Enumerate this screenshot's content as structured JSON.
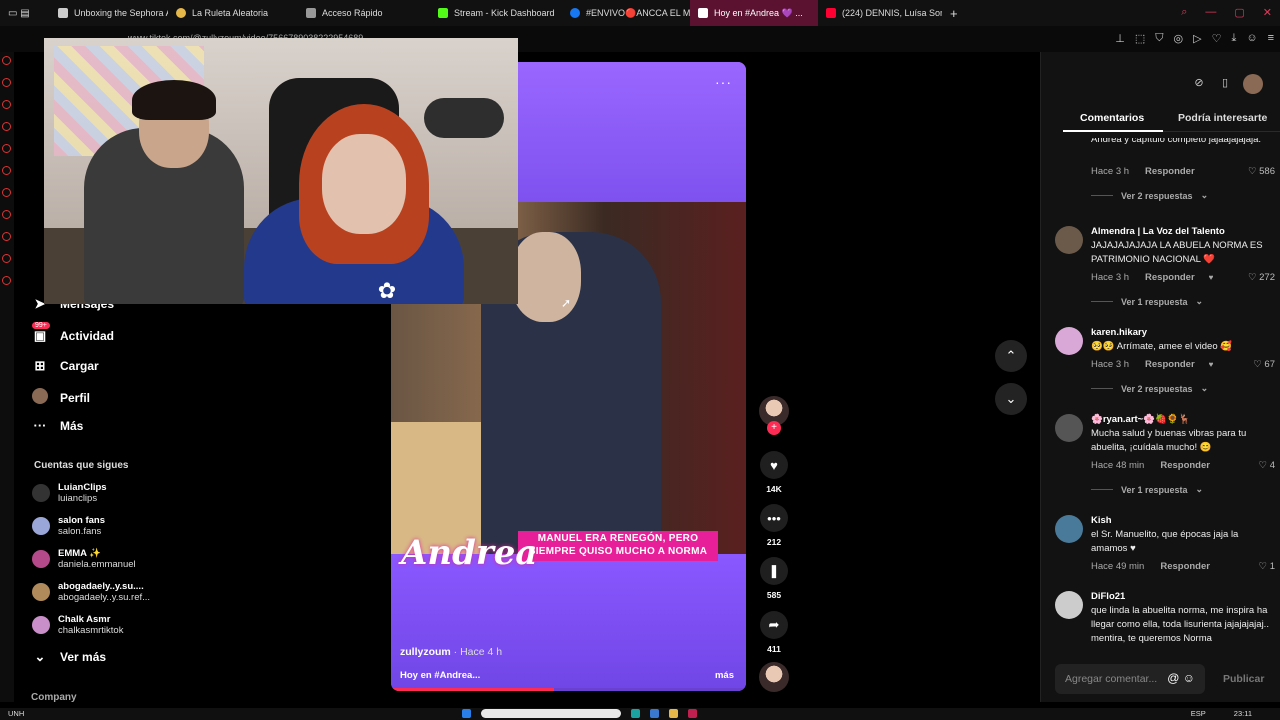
{
  "browser": {
    "tabs": [
      {
        "label": "Unboxing the Sephora Ad",
        "color": "#cccccc"
      },
      {
        "label": "La Ruleta Aleatoria",
        "color": "#e6b84a"
      },
      {
        "label": "Acceso Rápido",
        "color": "#999999"
      },
      {
        "label": "Stream - Kick Dashboard",
        "color": "#53fc18"
      },
      {
        "label": "#ENVIVO🔴ANCCA EL M",
        "color": "#1877f2"
      },
      {
        "label": "Hoy en #Andrea 💜 ...",
        "color": "#ffffff"
      },
      {
        "label": "(224) DENNIS, Luísa Sonz",
        "color": "#ff0033"
      }
    ],
    "new_tab_icon": "plus-icon",
    "url": "www.tiktok.com/@zullyzoum/video/7566789038222954689"
  },
  "nav": {
    "items": [
      {
        "label": "Mensajes",
        "icon": "paper-plane-icon"
      },
      {
        "label": "Actividad",
        "icon": "inbox-icon"
      },
      {
        "label": "Cargar",
        "icon": "upload-plus-icon"
      },
      {
        "label": "Perfil",
        "icon": "profile-avatar-icon"
      },
      {
        "label": "Más",
        "icon": "more-dots-icon"
      }
    ],
    "activity_badge": "99+",
    "following_title": "Cuentas que sigues",
    "following": [
      {
        "name": "LuianClips",
        "handle": "luianclips",
        "color": "#333333"
      },
      {
        "name": "salon fans",
        "handle": "salon.fans",
        "color": "#9aa6d8"
      },
      {
        "name": "EMMA ✨",
        "handle": "daniela.emmanuel",
        "color": "#b54a8a"
      },
      {
        "name": "abogadaely..y.su....",
        "handle": "abogadaely..y.su.ref...",
        "color": "#b08a5a"
      },
      {
        "name": "Chalk Asmr",
        "handle": "chalkasmrtiktok",
        "color": "#c98fc9"
      }
    ],
    "see_more": "Ver más",
    "company": "Company"
  },
  "video": {
    "overlay_title": "Andrea",
    "caption": "MANUEL ERA RENEGÓN, PERO SIEMPRE QUISO MUCHO A NORMA",
    "author": "zullyzoum",
    "time": " · Hace 4 h",
    "description": "Hoy en #Andrea...",
    "more": "más",
    "menu_icon": "more-horizontal-icon",
    "progress_fraction": 0.46
  },
  "actions": {
    "likes": "14K",
    "comments": "212",
    "saves": "585",
    "shares": "411"
  },
  "comments_panel": {
    "tab_comments": "Comentarios",
    "tab_interesting": "Podría interesarte",
    "items": [
      {
        "user": "",
        "text": "Andrea y capítulo completo jajaajajajaja.",
        "time": "Hace 3 h",
        "reply": "Responder",
        "likes": "586",
        "replies": "Ver 2 respuestas",
        "avatar": "#2a2a2a"
      },
      {
        "user": "Almendra | La Voz del Talento",
        "text": "JAJAJAJAJAJA LA ABUELA NORMA ES PATRIMONIO NACIONAL ❤️",
        "time": "Hace 3 h",
        "reply": "Responder",
        "likes": "272",
        "replies": "Ver 1 respuesta",
        "avatar": "#6b5a4a"
      },
      {
        "user": "karen.hikary",
        "text": "🥺🥺 Arrímate, amee el video 🥰",
        "time": "Hace 3 h",
        "reply": "Responder",
        "likes": "67",
        "replies": "Ver 2 respuestas",
        "avatar": "#d9a8d6"
      },
      {
        "user": "🌸ryan.art~🌸🍓🌻🦌",
        "text": "Mucha salud y buenas vibras para tu abuelita, ¡cuídala mucho! 😊",
        "time": "Hace 48 min",
        "reply": "Responder",
        "likes": "4",
        "replies": "Ver 1 respuesta",
        "avatar": "#555555"
      },
      {
        "user": "Kish",
        "text": "el Sr. Manuelito, que épocas jaja la amamos ♥",
        "time": "Hace 49 min",
        "reply": "Responder",
        "likes": "1",
        "replies": "",
        "avatar": "#4a7a9a"
      },
      {
        "user": "DiFlo21",
        "text": "que linda la abuelita norma, me inspira ha llegar como ella, toda lisurienta jajajajajaj.. mentira, te queremos Norma",
        "time": "",
        "reply": "",
        "likes": "",
        "replies": "",
        "avatar": "#cccccc"
      }
    ],
    "add_placeholder": "Agregar comentar...",
    "post_label": "Publicar"
  },
  "taskbar": {
    "left": "UNH",
    "lang": "ESP",
    "clock": "23:11"
  },
  "colors": {
    "accent": "#fe2c55",
    "video_bg": "#8a5cf0",
    "caption_strip": "#e7209a"
  }
}
